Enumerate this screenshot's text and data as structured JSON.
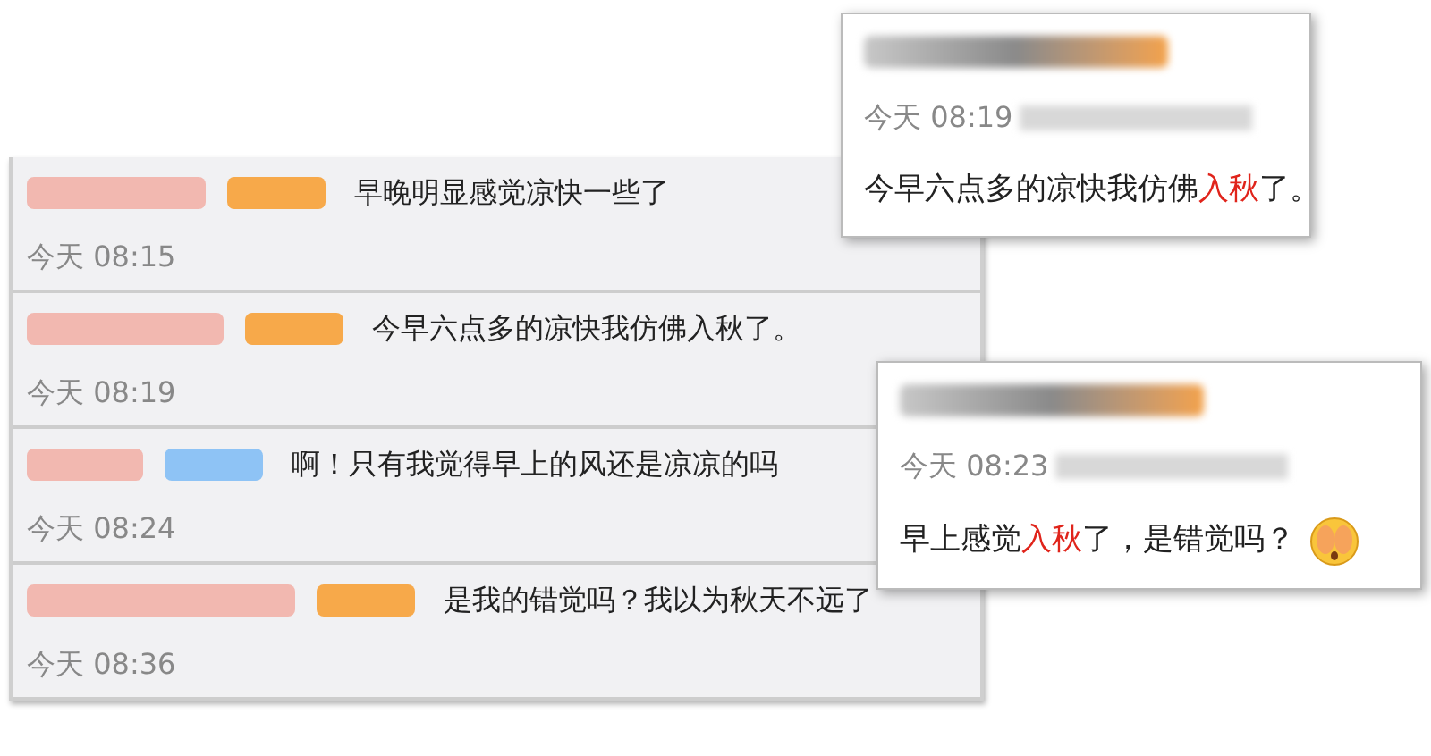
{
  "comments": [
    {
      "color": "#f7a94a",
      "text": "早晚明显感觉凉快一些了",
      "time": "今天 08:15"
    },
    {
      "color": "#f7a94a",
      "text": "今早六点多的凉快我仿佛入秋了。",
      "time": "今天 08:19"
    },
    {
      "color": "#8ec3f5",
      "text": "啊！只有我觉得早上的风还是凉凉的吗",
      "time": "今天 08:24"
    },
    {
      "color": "#f7a94a",
      "text": "是我的错觉吗？我以为秋天不远了",
      "time": "今天 08:36"
    }
  ],
  "cards": [
    {
      "time": "今天 08:19",
      "parts": [
        {
          "text": "今早六点多的凉快我仿佛",
          "highlight": false
        },
        {
          "text": "入秋",
          "highlight": true
        },
        {
          "text": "了。",
          "highlight": false
        }
      ],
      "emoji": false
    },
    {
      "time": "今天 08:23",
      "parts": [
        {
          "text": "早上感觉",
          "highlight": false
        },
        {
          "text": "入秋",
          "highlight": true
        },
        {
          "text": "了，是错觉吗？",
          "highlight": false
        }
      ],
      "emoji": true
    }
  ]
}
